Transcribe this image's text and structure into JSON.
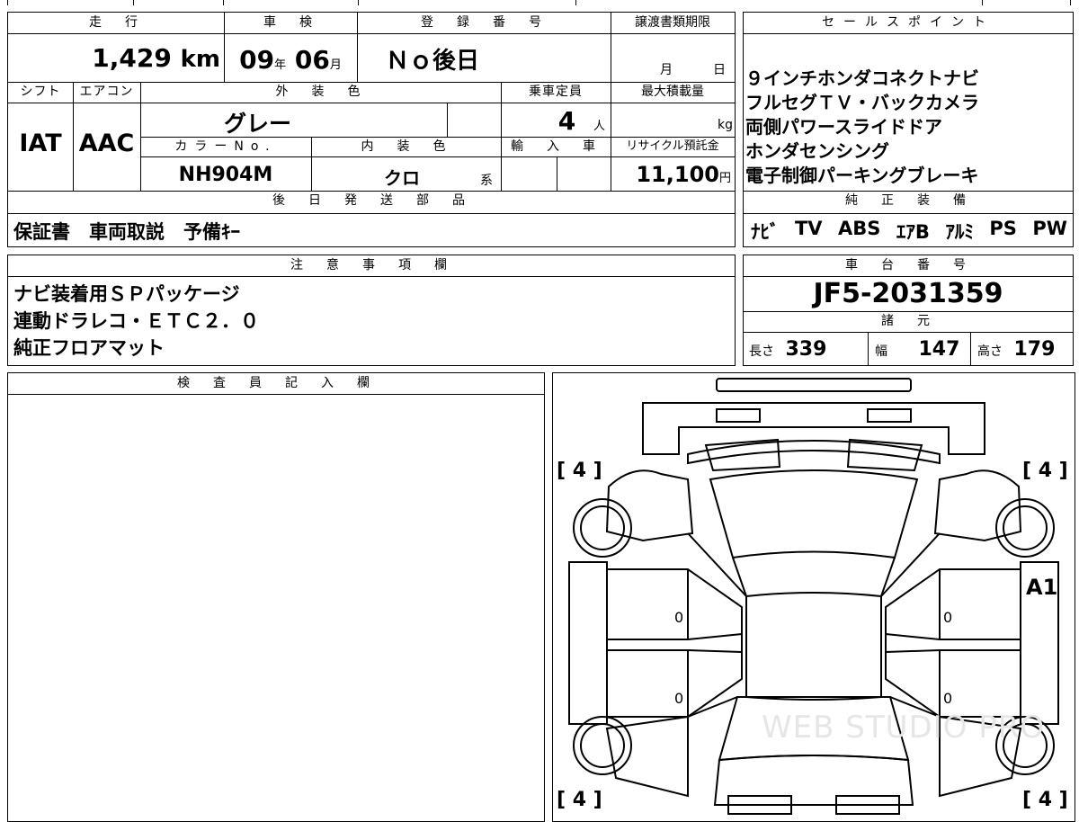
{
  "vehicle": {
    "mileage_header": "走　行",
    "mileage": "1,429",
    "mileage_unit": "km",
    "inspection_header": "車　検",
    "inspection_year": "09",
    "inspection_year_unit": "年",
    "inspection_month": "06",
    "inspection_month_unit": "月",
    "registration_header": "登　録　番　号",
    "registration": "Ｎｏ後日",
    "transfer_header": "譲渡書類期限",
    "transfer_month_unit": "月",
    "transfer_day_unit": "日",
    "shift_header": "シフト",
    "shift": "IAT",
    "ac_header": "エアコン",
    "ac": "AAC",
    "exterior_color_header": "外　装　色",
    "exterior_color": "グレー",
    "color_no_header": "カラーNo.",
    "color_no": "NH904M",
    "interior_color_header": "内　装　色",
    "interior_color": "クロ",
    "interior_color_suffix": "系",
    "capacity_header": "乗車定員",
    "capacity": "4",
    "capacity_unit": "人",
    "max_load_header": "最大積載量",
    "max_load_unit": "kg",
    "import_header": "輸　入　車",
    "recycle_header": "リサイクル預託金",
    "recycle_fee": "11,100",
    "recycle_unit": "円",
    "later_parts_header": "後　日　発　送　部　品",
    "later_parts": "保証書　車両取説　予備ｷｰ"
  },
  "sales_points": {
    "header": "セールスポイント",
    "lines": [
      "９インチホンダコネクトナビ",
      "フルセグＴＶ・バックカメラ",
      "両側パワースライドドア",
      "ホンダセンシング",
      "電子制御パーキングブレーキ"
    ]
  },
  "equipment": {
    "header": "純　正　装　備",
    "items": [
      "ﾅﾋﾞ",
      "TV",
      "ABS",
      "ｴｱB",
      "ｱﾙﾐ",
      "PS",
      "PW"
    ]
  },
  "notes": {
    "header": "注　意　事　項　欄",
    "lines": [
      "ナビ装着用ＳＰパッケージ",
      "連動ドラレコ・ＥＴＣ２．０",
      "純正フロアマット"
    ]
  },
  "chassis": {
    "header": "車　台　番　号",
    "number": "JF5-2031359",
    "specs_header": "諸　元",
    "length_label": "長さ",
    "length": "339",
    "width_label": "幅",
    "width": "147",
    "height_label": "高さ",
    "height": "179"
  },
  "inspector": {
    "header": "検　査　員　記　入　欄"
  },
  "diagram": {
    "tire_front_left": "[ 4 ]",
    "tire_front_right": "[ 4 ]",
    "tire_rear_left": "[ 4 ]",
    "tire_rear_right": "[ 4 ]",
    "damage_code": "A1",
    "panel_left_front": "0",
    "panel_left_rear": "0",
    "panel_right_front": "0",
    "panel_right_rear": "0",
    "watermark": "WEB STUDIO PRO"
  }
}
